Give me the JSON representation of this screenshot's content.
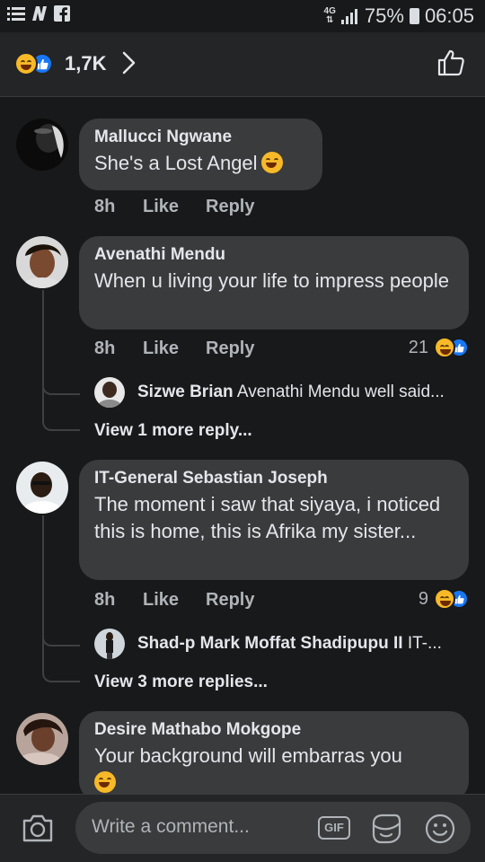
{
  "status_bar": {
    "network": "4G",
    "battery": "75%",
    "time": "06:05"
  },
  "header": {
    "reaction_count": "1,7K"
  },
  "comments": [
    {
      "name": "Mallucci Ngwane",
      "text": "She's a Lost Angel",
      "time": "8h",
      "like": "Like",
      "reply": "Reply"
    },
    {
      "name": "Avenathi Mendu",
      "text": "When u living your life to impress people",
      "time": "8h",
      "like": "Like",
      "reply": "Reply",
      "reactions": "21",
      "reply_preview": {
        "author": "Sizwe Brian",
        "text": "Avenathi Mendu well said..."
      },
      "view_more": "View 1 more reply..."
    },
    {
      "name": "IT-General Sebastian Joseph",
      "text": "The moment i saw that siyaya, i noticed this is home, this is Afrika my sister...",
      "time": "8h",
      "like": "Like",
      "reply": "Reply",
      "reactions": "9",
      "reply_preview": {
        "author": "Shad-p Mark Moffat Shadipupu II",
        "text": "IT-..."
      },
      "view_more": "View 3 more replies..."
    },
    {
      "name": "Desire Mathabo Mokgope",
      "text": "Your background will embarras you"
    }
  ],
  "composer": {
    "placeholder": "Write a comment...",
    "gif_label": "GIF"
  },
  "colors": {
    "background": "#18191a",
    "bubble": "#3a3b3c",
    "like_blue": "#1877f2",
    "haha_yellow": "#f7b928"
  }
}
